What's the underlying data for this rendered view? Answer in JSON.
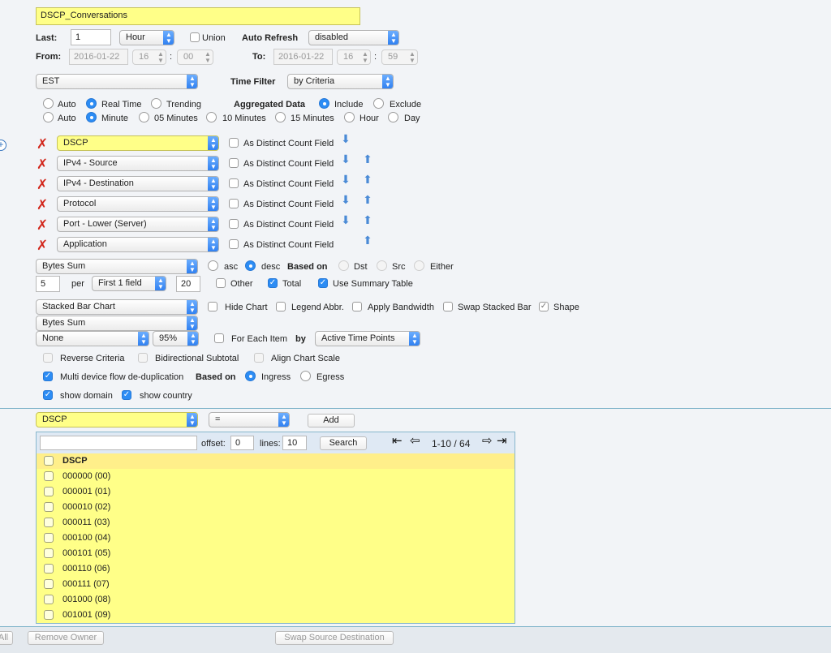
{
  "report_name": "DSCP_Conversations",
  "time": {
    "last_label": "Last:",
    "last_value": "1",
    "last_unit": "Hour",
    "union_label": "Union",
    "auto_refresh_label": "Auto Refresh",
    "auto_refresh_value": "disabled",
    "from_label": "From:",
    "from_date": "2016-01-22",
    "from_hour": "16",
    "from_min": "00",
    "to_label": "To:",
    "to_date": "2016-01-22",
    "to_hour": "16",
    "to_min": "59",
    "colon": ":",
    "timezone": "EST",
    "time_filter_label": "Time Filter",
    "time_filter_value": "by Criteria"
  },
  "mode_row1": {
    "options": [
      "Auto",
      "Real Time",
      "Trending"
    ],
    "selected": "Real Time",
    "aggregated_label": "Aggregated Data",
    "agg_options": [
      "Include",
      "Exclude"
    ],
    "agg_selected": "Include"
  },
  "mode_row2": {
    "options": [
      "Auto",
      "Minute",
      "05 Minutes",
      "10 Minutes",
      "15 Minutes",
      "Hour",
      "Day"
    ],
    "selected": "Minute"
  },
  "fields": [
    {
      "name": "DSCP",
      "distinct_label": "As Distinct Count Field",
      "highlight": true
    },
    {
      "name": "IPv4 - Source",
      "distinct_label": "As Distinct Count Field",
      "highlight": false
    },
    {
      "name": "IPv4 - Destination",
      "distinct_label": "As Distinct Count Field",
      "highlight": false
    },
    {
      "name": "Protocol",
      "distinct_label": "As Distinct Count Field",
      "highlight": false
    },
    {
      "name": "Port - Lower (Server)",
      "distinct_label": "As Distinct Count Field",
      "highlight": false
    },
    {
      "name": "Application",
      "distinct_label": "As Distinct Count Field",
      "highlight": false
    }
  ],
  "sort": {
    "metric": "Bytes Sum",
    "asc_label": "asc",
    "desc_label": "desc",
    "order": "desc",
    "based_on_label": "Based on",
    "based_options": [
      "Dst",
      "Src",
      "Either"
    ],
    "top_n": "5",
    "per_label": "per",
    "per_value": "First 1 field",
    "secondary_n": "20",
    "other_label": "Other",
    "other_checked": false,
    "total_label": "Total",
    "total_checked": true,
    "summary_label": "Use Summary Table",
    "summary_checked": true
  },
  "chart": {
    "type": "Stacked Bar Chart",
    "hide_chart": "Hide Chart",
    "legend_abbr": "Legend Abbr.",
    "apply_bandwidth": "Apply Bandwidth",
    "swap_stacked": "Swap Stacked Bar",
    "shape": "Shape",
    "metric": "Bytes Sum",
    "trend": "None",
    "percentile": "95%",
    "for_each_item": "For Each Item",
    "by_label": "by",
    "by_value": "Active Time Points"
  },
  "options": {
    "reverse_criteria": "Reverse Criteria",
    "bidirectional_subtotal": "Bidirectional Subtotal",
    "align_chart_scale": "Align Chart Scale",
    "multi_device": "Multi device flow de-duplication",
    "based_on_label": "Based on",
    "ingress": "Ingress",
    "egress": "Egress",
    "show_domain": "show domain",
    "show_country": "show country"
  },
  "filter": {
    "field": "DSCP",
    "operator": "=",
    "add_label": "Add",
    "search_value": "",
    "offset_label": "offset:",
    "offset_value": "0",
    "lines_label": "lines:",
    "lines_value": "10",
    "search_label": "Search",
    "page_info": "1-10 / 64",
    "column_header": "DSCP",
    "rows": [
      "000000 (00)",
      "000001 (01)",
      "000010 (02)",
      "000011 (03)",
      "000100 (04)",
      "000101 (05)",
      "000110 (06)",
      "000111 (07)",
      "001000 (08)",
      "001001 (09)"
    ]
  },
  "footer": {
    "all_label": "All",
    "remove_owner": "Remove Owner",
    "swap_src_dst": "Swap Source Destination"
  },
  "icons": {
    "remove": "red-x-icon",
    "move_down": "arrow-down-icon",
    "move_up": "arrow-up-icon",
    "expand": "plus-circle-icon",
    "first_page": "first-page-icon",
    "prev_page": "prev-page-icon",
    "next_page": "next-page-icon",
    "last_page": "last-page-icon"
  }
}
